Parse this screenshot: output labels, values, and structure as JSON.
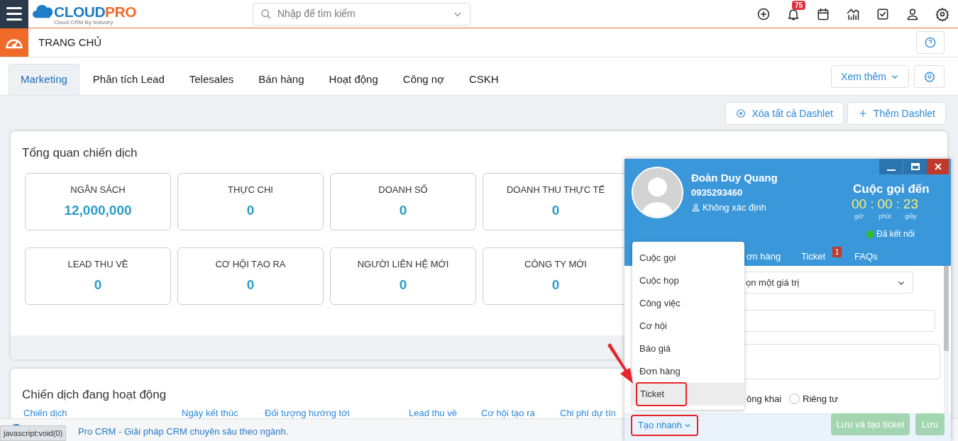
{
  "topbar": {
    "logo": {
      "first": "CLOUD",
      "second": "PRO",
      "tagline": "Cloud CRM By Industry"
    },
    "search": {
      "placeholder": "Nhập để tìm kiếm"
    },
    "notification_count": "75"
  },
  "breadcrumb": {
    "title": "TRANG CHỦ"
  },
  "tabs": [
    {
      "label": "Marketing",
      "selected": true
    },
    {
      "label": "Phân tích Lead",
      "selected": false
    },
    {
      "label": "Telesales",
      "selected": false
    },
    {
      "label": "Bán hàng",
      "selected": false
    },
    {
      "label": "Hoạt động",
      "selected": false
    },
    {
      "label": "Công nợ",
      "selected": false
    },
    {
      "label": "CSKH",
      "selected": false
    }
  ],
  "more_button": "Xem thêm",
  "dashlet_buttons": [
    {
      "kind": "clear",
      "label": "Xóa tất cả Dashlet"
    },
    {
      "kind": "add",
      "label": "Thêm Dashlet"
    }
  ],
  "overview": {
    "title": "Tổng quan chiến dịch",
    "stats": [
      {
        "label": "NGÂN SÁCH",
        "value": "12,000,000"
      },
      {
        "label": "THỰC CHI",
        "value": "0"
      },
      {
        "label": "DOANH SỐ",
        "value": "0"
      },
      {
        "label": "DOANH THU THỰC TẾ",
        "value": "0"
      },
      {
        "label": "LEAD THU VỀ",
        "value": "0"
      },
      {
        "label": "CƠ HỘI TẠO RA",
        "value": "0"
      },
      {
        "label": "NGƯỜI LIÊN HỆ MỚI",
        "value": "0"
      },
      {
        "label": "CÔNG TY MỚI",
        "value": "0"
      }
    ]
  },
  "active_campaigns": {
    "title": "Chiến dịch đang hoạt động",
    "columns": [
      "Chiến dịch",
      "Ngày kết thúc",
      "Đối tượng hướng tới",
      "Lead thu về",
      "Cơ hội tạo ra",
      "Chi phí dự tín"
    ]
  },
  "footer": {
    "text": "Pro CRM - Giải pháp CRM chuyên sâu theo ngành.",
    "status_tooltip": "javascript:void(0)"
  },
  "call_popup": {
    "name": "Đoàn Duy Quang",
    "phone": "0935293460",
    "contact_status": "Không xác định",
    "call_type": "Cuộc gọi đến",
    "timer_separator": ":",
    "timer": [
      {
        "value": "00",
        "unit": "giờ"
      },
      {
        "value": "00",
        "unit": "phút"
      },
      {
        "value": "23",
        "unit": "giây"
      }
    ],
    "connection": {
      "label": "Đã kết nối",
      "color": "#2ebd2e"
    },
    "tabs": [
      {
        "label": "ơn hàng"
      },
      {
        "label": "Ticket",
        "badge": "1"
      },
      {
        "label": "FAQs"
      }
    ],
    "select_placeholder": "ọn một giá trị",
    "visibility": [
      {
        "label": "ông khai",
        "selected": false
      },
      {
        "label": "Riêng tư",
        "selected": false
      }
    ],
    "quick_create": {
      "label": "Tạo nhanh",
      "menu": [
        {
          "label": "Cuộc gọi",
          "selected": false
        },
        {
          "label": "Cuộc họp",
          "selected": false
        },
        {
          "label": "Công việc",
          "selected": false
        },
        {
          "label": "Cơ hội",
          "selected": false
        },
        {
          "label": "Báo giá",
          "selected": false
        },
        {
          "label": "Đơn hàng",
          "selected": false
        },
        {
          "label": "Ticket",
          "selected": true
        }
      ]
    },
    "buttons": [
      "Lưu và tạo ticket",
      "Lưu"
    ]
  }
}
